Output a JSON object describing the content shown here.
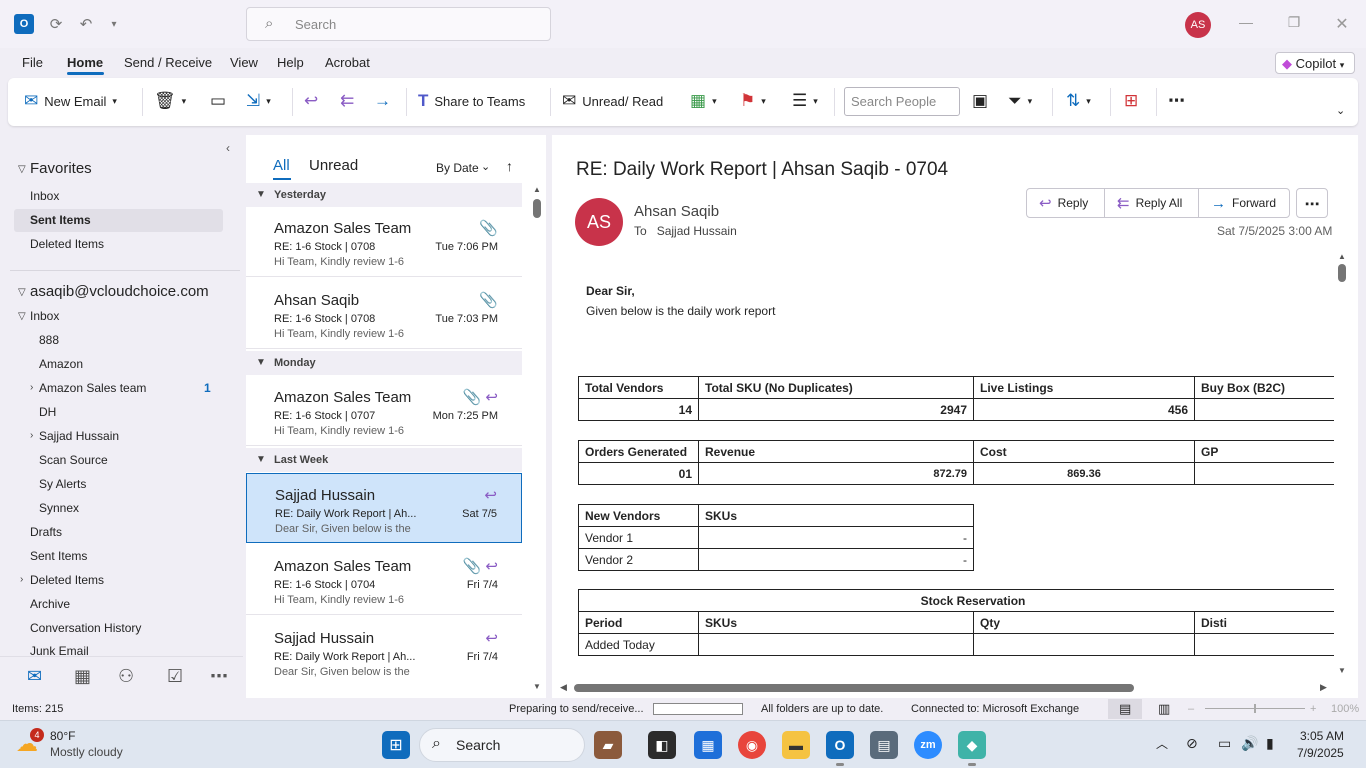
{
  "titlebar": {
    "search_placeholder": "Search",
    "avatar_initials": "AS"
  },
  "menu": {
    "items": [
      "File",
      "Home",
      "Send / Receive",
      "View",
      "Help",
      "Acrobat"
    ],
    "copilot": "Copilot"
  },
  "ribbon": {
    "new_email": "New Email",
    "share_to_teams": "Share to Teams",
    "unread_read": "Unread/ Read",
    "search_people_placeholder": "Search People"
  },
  "folders": {
    "favorites_header": "Favorites",
    "favorites": [
      "Inbox",
      "Sent Items",
      "Deleted Items"
    ],
    "account": "asaqib@vcloudchoice.com",
    "inbox": "Inbox",
    "inbox_sub": [
      {
        "label": "888"
      },
      {
        "label": "Amazon"
      },
      {
        "label": "Amazon Sales team",
        "count": "1"
      },
      {
        "label": "DH"
      },
      {
        "label": "Sajjad Hussain"
      },
      {
        "label": "Scan Source"
      },
      {
        "label": "Sy Alerts"
      },
      {
        "label": "Synnex"
      }
    ],
    "others": [
      "Drafts",
      "Sent Items",
      "Deleted Items",
      "Archive",
      "Conversation History",
      "Junk Email"
    ]
  },
  "message_list": {
    "tab_all": "All",
    "tab_unread": "Unread",
    "sort": "By Date",
    "groups": [
      "Yesterday",
      "Monday",
      "Last Week"
    ],
    "messages": [
      {
        "from": "Amazon Sales Team",
        "subject": "RE: 1-6 Stock | 0708",
        "date": "Tue 7:06 PM",
        "preview": "Hi Team,  Kindly review 1-6"
      },
      {
        "from": "Ahsan Saqib",
        "subject": "RE: 1-6 Stock | 0708",
        "date": "Tue 7:03 PM",
        "preview": "Hi Team,  Kindly review 1-6"
      },
      {
        "from": "Amazon Sales Team",
        "subject": "RE: 1-6 Stock | 0707",
        "date": "Mon 7:25 PM",
        "preview": "Hi Team,  Kindly review 1-6"
      },
      {
        "from": "Sajjad Hussain",
        "subject": "RE: Daily Work Report | Ah...",
        "date": "Sat 7/5",
        "preview": "Dear Sir,  Given below is the"
      },
      {
        "from": "Amazon Sales Team",
        "subject": "RE: 1-6 Stock | 0704",
        "date": "Fri 7/4",
        "preview": "Hi Team,  Kindly review 1-6"
      },
      {
        "from": "Sajjad Hussain",
        "subject": "RE: Daily Work Report | Ah...",
        "date": "Fri 7/4",
        "preview": "Dear Sir,  Given below is the"
      }
    ]
  },
  "reading": {
    "subject": "RE: Daily Work Report | Ahsan Saqib - 0704",
    "avatar": "AS",
    "sender": "Ahsan Saqib",
    "to_label": "To",
    "to": "Sajjad Hussain",
    "reply": "Reply",
    "reply_all": "Reply All",
    "forward": "Forward",
    "date": "Sat 7/5/2025 3:00 AM",
    "greeting": "Dear Sir,",
    "intro": "Given below is the daily work report",
    "table1": {
      "headers": [
        "Total Vendors",
        "Total SKU (No Duplicates)",
        "Live Listings",
        "Buy Box (B2C)"
      ],
      "values": [
        "14",
        "2947",
        "456",
        ""
      ]
    },
    "table2": {
      "headers": [
        "Orders Generated",
        "Revenue",
        "Cost",
        "GP"
      ],
      "values": [
        "01",
        "872.79",
        "869.36",
        ""
      ]
    },
    "table3": {
      "headers": [
        "New Vendors",
        "SKUs"
      ],
      "rows": [
        [
          "Vendor 1",
          "-"
        ],
        [
          "Vendor 2",
          "-"
        ]
      ]
    },
    "table4": {
      "title": "Stock Reservation",
      "headers": [
        "Period",
        "SKUs",
        "Qty",
        "Disti"
      ],
      "rows": [
        [
          "Added Today",
          "",
          "",
          ""
        ]
      ]
    }
  },
  "status": {
    "items": "Items: 215",
    "sending": "Preparing to send/receive...",
    "uptodate": "All folders are up to date.",
    "connected": "Connected to: Microsoft Exchange",
    "zoom": "100%"
  },
  "taskbar": {
    "weather_badge": "4",
    "temp": "80°F",
    "condition": "Mostly cloudy",
    "search": "Search",
    "time": "3:05 AM",
    "date": "7/9/2025"
  }
}
